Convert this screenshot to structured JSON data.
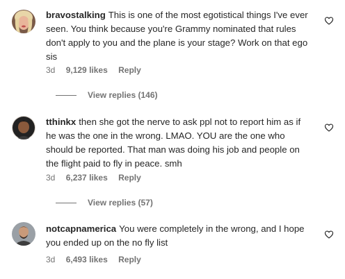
{
  "comments": [
    {
      "username": "bravostalking",
      "text": "This is one of the most egotistical things I've ever seen. You think because you're Grammy nominated that rules don't apply to you and the plane is your stage? Work on that ego sis",
      "time": "3d",
      "likes": "9,129 likes",
      "reply": "Reply",
      "view_replies": "View replies (146)",
      "icons": {
        "avatar": "avatar-photo",
        "like": "heart-outline-icon"
      }
    },
    {
      "username": "tthinkx",
      "text": "then she got the nerve to ask ppl not to report him as if he was the one in the wrong. LMAO. YOU are the one who should be reported. That man was doing his job and people on the flight paid to fly in peace. smh",
      "time": "3d",
      "likes": "6,237 likes",
      "reply": "Reply",
      "view_replies": "View replies (57)",
      "icons": {
        "avatar": "avatar-photo",
        "like": "heart-outline-icon"
      }
    },
    {
      "username": "notcapnamerica",
      "text": "You were completely in the wrong, and I hope you ended up on the no fly list",
      "time": "3d",
      "likes": "6,493 likes",
      "reply": "Reply",
      "icons": {
        "avatar": "avatar-photo",
        "like": "heart-outline-icon"
      }
    }
  ],
  "colors": {
    "text": "#262626",
    "secondary": "#737373",
    "background": "#ffffff"
  }
}
